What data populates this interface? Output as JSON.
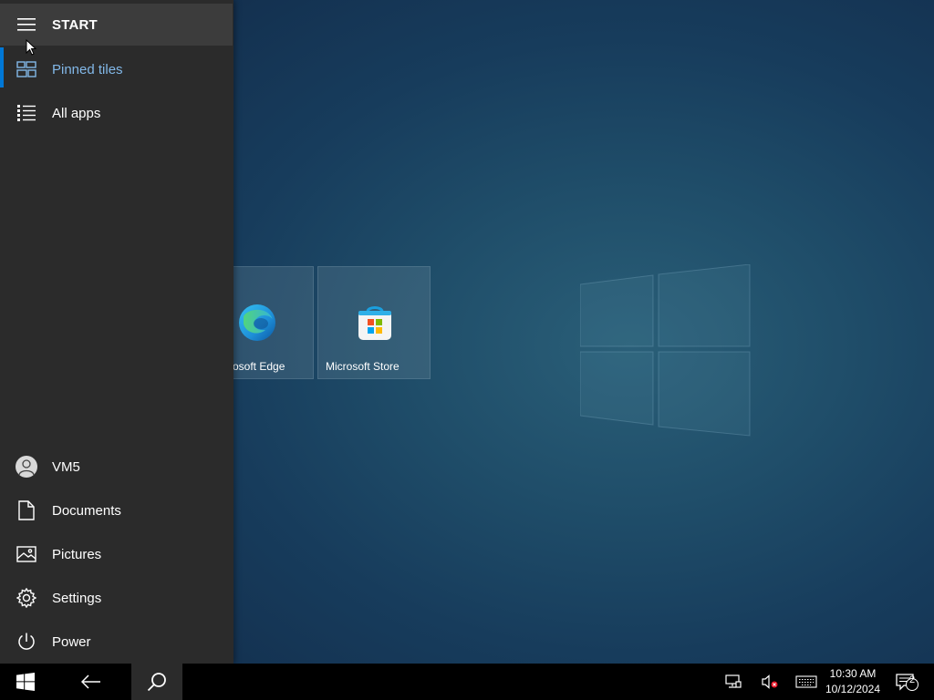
{
  "start_menu": {
    "title": "START",
    "top_items": [
      {
        "label": "Pinned tiles",
        "icon": "tiles-icon",
        "selected": true
      },
      {
        "label": "All apps",
        "icon": "list-icon"
      }
    ],
    "bottom_items": [
      {
        "label": "VM5",
        "icon": "user-avatar-icon"
      },
      {
        "label": "Documents",
        "icon": "document-icon"
      },
      {
        "label": "Pictures",
        "icon": "pictures-icon"
      },
      {
        "label": "Settings",
        "icon": "gear-icon"
      },
      {
        "label": "Power",
        "icon": "power-icon"
      }
    ]
  },
  "tiles": [
    {
      "label": "Microsoft Edge",
      "visible_label": "osoft Edge",
      "icon": "edge-icon"
    },
    {
      "label": "Microsoft Store",
      "icon": "store-icon"
    }
  ],
  "taskbar": {
    "buttons": [
      "windows-start-icon",
      "back-arrow-icon",
      "search-icon"
    ],
    "tray": [
      "network-icon",
      "volume-muted-icon",
      "keyboard-icon"
    ],
    "time": "10:30 AM",
    "date": "10/12/2024",
    "notification_count": "2"
  },
  "colors": {
    "accent": "#0078d7",
    "pane": "#2b2b2b",
    "selected_text": "#82b8e8"
  }
}
